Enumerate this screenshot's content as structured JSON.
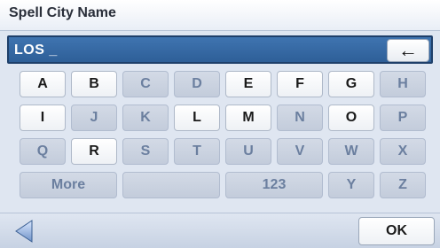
{
  "header": {
    "title": "Spell City Name"
  },
  "entry": {
    "value": "LOS _"
  },
  "keyboard": {
    "rows": [
      [
        "A",
        "B",
        "C",
        "D",
        "E",
        "F",
        "G",
        "H"
      ],
      [
        "I",
        "J",
        "K",
        "L",
        "M",
        "N",
        "O",
        "P"
      ],
      [
        "Q",
        "R",
        "S",
        "T",
        "U",
        "V",
        "W",
        "X"
      ],
      [
        "More",
        "",
        "123",
        "Y",
        "Z"
      ]
    ]
  },
  "footer": {
    "ok_label": "OK"
  },
  "colors": {
    "entry_bg": "#3a6ea8",
    "key_enabled": "#ffffff",
    "key_disabled": "#cfd7e4",
    "text_disabled": "#6b7f9f"
  },
  "icons": {
    "backspace": "left-arrow",
    "back": "triangle-left"
  }
}
